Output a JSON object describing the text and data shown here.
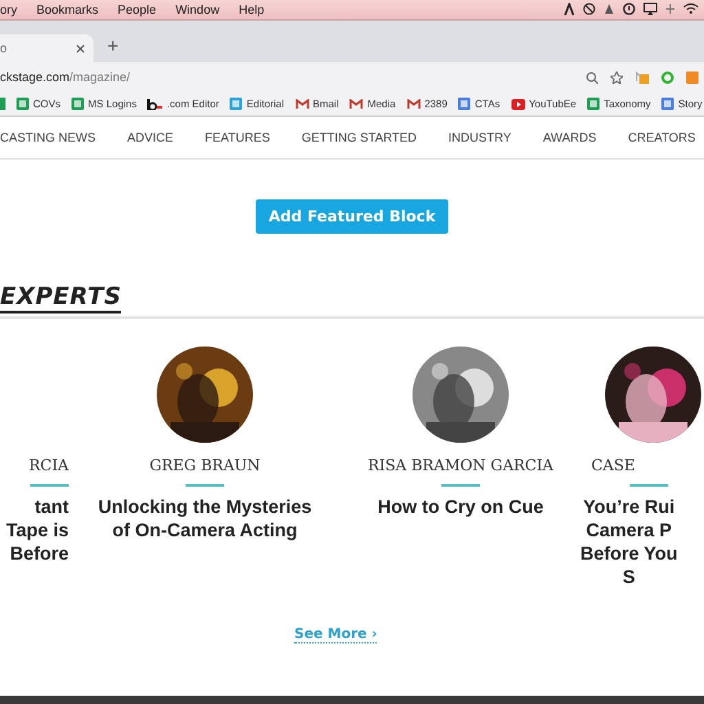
{
  "menu_bar": {
    "items": [
      "ory",
      "Bookmarks",
      "People",
      "Window",
      "Help"
    ]
  },
  "tab_bar": {
    "tab_title": "o",
    "new_tab": "+"
  },
  "address_bar": {
    "domain": "ckstage.com",
    "path": "/magazine/"
  },
  "bookmarks": [
    {
      "label": "COVs",
      "kind": "sheet"
    },
    {
      "label": "MS Logins",
      "kind": "sheet"
    },
    {
      "label": ".com Editor",
      "kind": "be"
    },
    {
      "label": "Editorial",
      "kind": "board"
    },
    {
      "label": "Bmail",
      "kind": "mail"
    },
    {
      "label": "Media",
      "kind": "mail"
    },
    {
      "label": "2389",
      "kind": "mail"
    },
    {
      "label": "CTAs",
      "kind": "doc"
    },
    {
      "label": "YouTubEe",
      "kind": "video"
    },
    {
      "label": "Taxonomy",
      "kind": "sheet"
    },
    {
      "label": "Story",
      "kind": "doc"
    }
  ],
  "nav": [
    "CASTING NEWS",
    "ADVICE",
    "FEATURES",
    "GETTING STARTED",
    "INDUSTRY",
    "AWARDS",
    "CREATORS"
  ],
  "add_button": "Add Featured Block",
  "section_title": "EXPERTS",
  "experts": [
    {
      "name": "RCIA",
      "title": [
        "tant",
        "Tape is",
        "Before"
      ]
    },
    {
      "name": "GREG BRAUN",
      "title": [
        "Unlocking the Mysteries",
        "of On-Camera Acting"
      ]
    },
    {
      "name": "RISA BRAMON GARCIA",
      "title": [
        "How to Cry on Cue"
      ]
    },
    {
      "name": "CASE",
      "title": [
        "You’re Rui",
        "Camera P",
        "Before You",
        "S"
      ]
    }
  ],
  "see_more": "See More ›"
}
